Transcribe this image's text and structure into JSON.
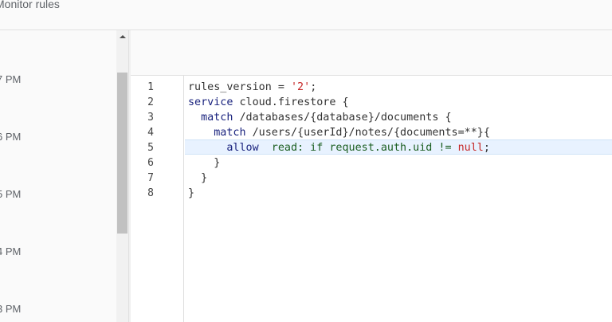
{
  "header": {
    "title": "Monitor rules"
  },
  "history": {
    "times": [
      "7 PM",
      "6 PM",
      "5 PM",
      "4 PM",
      "3 PM"
    ]
  },
  "editor": {
    "lines": [
      {
        "number": "1",
        "tokens": [
          {
            "t": "rules_version = ",
            "c": "plain"
          },
          {
            "t": "'2'",
            "c": "string"
          },
          {
            "t": ";",
            "c": "plain"
          }
        ]
      },
      {
        "number": "2",
        "tokens": [
          {
            "t": "service",
            "c": "keyword"
          },
          {
            "t": " cloud.firestore {",
            "c": "plain"
          }
        ]
      },
      {
        "number": "3",
        "tokens": [
          {
            "t": "  ",
            "c": "plain"
          },
          {
            "t": "match",
            "c": "keyword"
          },
          {
            "t": " /databases/{database}/documents {",
            "c": "plain"
          }
        ]
      },
      {
        "number": "4",
        "tokens": [
          {
            "t": "    ",
            "c": "plain"
          },
          {
            "t": "match",
            "c": "keyword"
          },
          {
            "t": " /users/{userId}/notes/{documents=**}{",
            "c": "plain"
          }
        ]
      },
      {
        "number": "5",
        "tokens": [
          {
            "t": "      ",
            "c": "plain"
          },
          {
            "t": "allow",
            "c": "keyword"
          },
          {
            "t": "  read: if request.auth.uid != ",
            "c": "builtin"
          },
          {
            "t": "null",
            "c": "null"
          },
          {
            "t": ";",
            "c": "plain"
          }
        ]
      },
      {
        "number": "6",
        "tokens": [
          {
            "t": "    }",
            "c": "plain"
          }
        ]
      },
      {
        "number": "7",
        "tokens": [
          {
            "t": "  }",
            "c": "plain"
          }
        ]
      },
      {
        "number": "8",
        "tokens": [
          {
            "t": "}",
            "c": "plain"
          }
        ]
      }
    ],
    "active_line": 5
  },
  "icons": {
    "scroll_up": "scroll-up-arrow-icon"
  },
  "colors": {
    "active_line_bg": "#e8f2ff",
    "keyword": "#1a237e",
    "string": "#c62828",
    "builtin": "#1b5e20"
  }
}
